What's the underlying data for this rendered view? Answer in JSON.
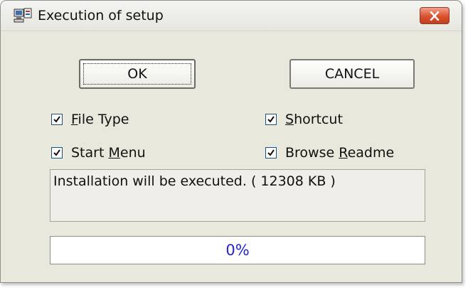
{
  "window": {
    "title": "Execution of setup",
    "app_icon": "setup-computer-icon",
    "close_icon": "close-icon"
  },
  "buttons": {
    "ok": "OK",
    "cancel": "CANCEL"
  },
  "options": {
    "file_type": {
      "mnemonic": "F",
      "rest": "ile Type",
      "checked": true
    },
    "shortcut": {
      "mnemonic": "S",
      "rest": "hortcut",
      "checked": true
    },
    "start_menu": {
      "before": "Start ",
      "mnemonic": "M",
      "rest": "enu",
      "checked": true
    },
    "browse_readme": {
      "before": "Browse ",
      "mnemonic": "R",
      "rest": "eadme",
      "checked": true
    }
  },
  "status_text": "Installation will be executed. ( 12308 KB )",
  "progress": {
    "value": 0,
    "label": "0%"
  },
  "colors": {
    "close_button": "#d9512d",
    "progress_text": "#2323d8",
    "window_bg": "#e9e8dd"
  }
}
